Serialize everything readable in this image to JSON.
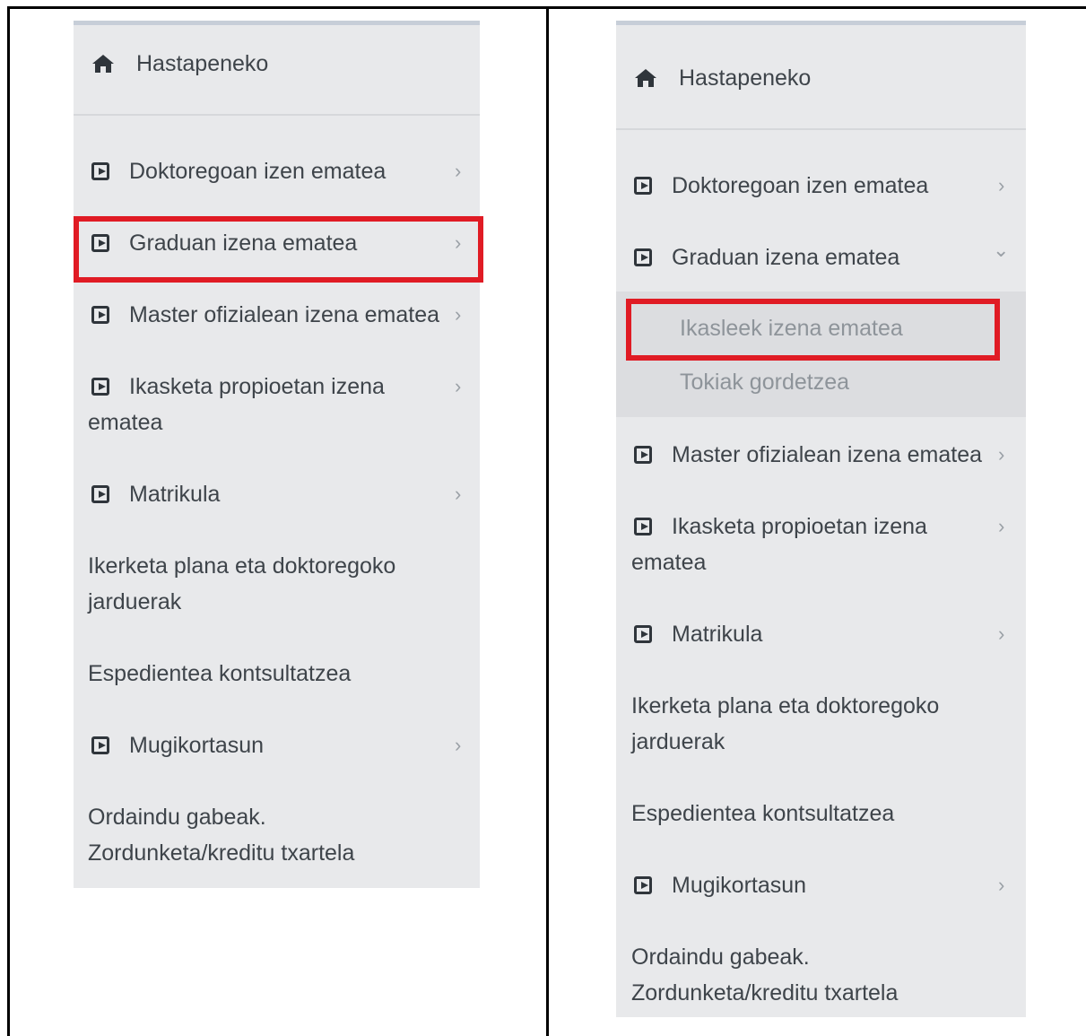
{
  "panels": [
    {
      "home_label": "Hastapeneko",
      "items": [
        {
          "label": "Doktoregoan izen ematea",
          "has_icon": true,
          "chevron": "›"
        },
        {
          "label": "Graduan izena ematea",
          "has_icon": true,
          "chevron": "›",
          "highlighted": true
        },
        {
          "label": "Master ofizialean izena ematea",
          "has_icon": true,
          "chevron": "›"
        },
        {
          "label_line1": "Ikasketa propioetan izena",
          "label_line2": "ematea",
          "has_icon": true,
          "chevron": "›"
        },
        {
          "label": "Matrikula",
          "has_icon": true,
          "chevron": "›"
        },
        {
          "label_line1": "Ikerketa plana eta doktoregoko",
          "label_line2": "jarduerak",
          "has_icon": false
        },
        {
          "label": "Espedientea kontsultatzea",
          "has_icon": false
        },
        {
          "label": "Mugikortasun",
          "has_icon": true,
          "chevron": "›"
        },
        {
          "label_line1": "Ordaindu gabeak.",
          "label_line2": "Zordunketa/kreditu txartela",
          "has_icon": false
        }
      ]
    },
    {
      "home_label": "Hastapeneko",
      "items": [
        {
          "label": "Doktoregoan izen ematea",
          "has_icon": true,
          "chevron": "›"
        },
        {
          "label": "Graduan izena ematea",
          "has_icon": true,
          "chevron": "⌄",
          "expanded": true
        },
        {
          "label": "Master ofizialean izena ematea",
          "has_icon": true,
          "chevron": "›"
        },
        {
          "label_line1": "Ikasketa propioetan izena",
          "label_line2": "ematea",
          "has_icon": true,
          "chevron": "›"
        },
        {
          "label": "Matrikula",
          "has_icon": true,
          "chevron": "›"
        },
        {
          "label_line1": "Ikerketa plana eta doktoregoko",
          "label_line2": "jarduerak",
          "has_icon": false
        },
        {
          "label": "Espedientea kontsultatzea",
          "has_icon": false
        },
        {
          "label": "Mugikortasun",
          "has_icon": true,
          "chevron": "›"
        },
        {
          "label_line1": "Ordaindu gabeak.",
          "label_line2": "Zordunketa/kreditu txartela",
          "has_icon": false
        }
      ],
      "subitems": [
        {
          "label": "Ikasleek izena ematea",
          "highlighted": true
        },
        {
          "label": "Tokiak gordetzea"
        }
      ]
    }
  ],
  "colors": {
    "highlight": "#e01b24",
    "panel_bg": "#e8e9eb",
    "submenu_bg": "#dcdde0"
  }
}
